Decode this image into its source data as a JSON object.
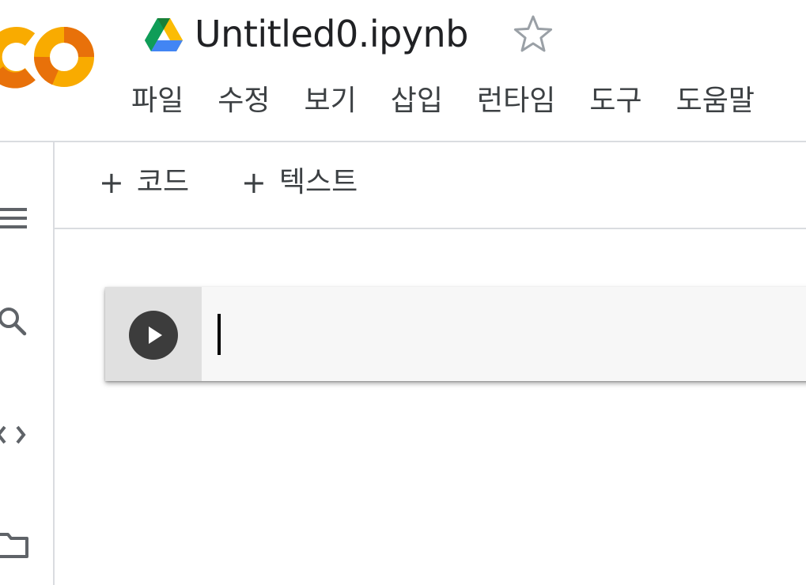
{
  "header": {
    "title": "Untitled0.ipynb",
    "logo_icon": "colab-logo-icon",
    "drive_icon": "google-drive-icon",
    "star_icon": "star-outline-icon"
  },
  "menu": {
    "items": [
      {
        "label": "파일"
      },
      {
        "label": "수정"
      },
      {
        "label": "보기"
      },
      {
        "label": "삽입"
      },
      {
        "label": "런타임"
      },
      {
        "label": "도구"
      },
      {
        "label": "도움말"
      }
    ]
  },
  "sidebar": {
    "icons": [
      "menu-icon",
      "search-icon",
      "code-snippets-icon",
      "folder-icon"
    ]
  },
  "toolbar": {
    "add_code_plus": "+",
    "add_code_label": "코드",
    "add_text_plus": "+",
    "add_text_label": "텍스트"
  },
  "cell": {
    "run_icon": "play-icon",
    "code": ""
  },
  "colors": {
    "logo_orange": "#F9AB00",
    "logo_dark_orange": "#E8710A",
    "run_button": "#3C3C3C",
    "cell_background": "#F7F7F7",
    "gutter_background": "#E0E0E0",
    "divider": "#DADCE0"
  }
}
